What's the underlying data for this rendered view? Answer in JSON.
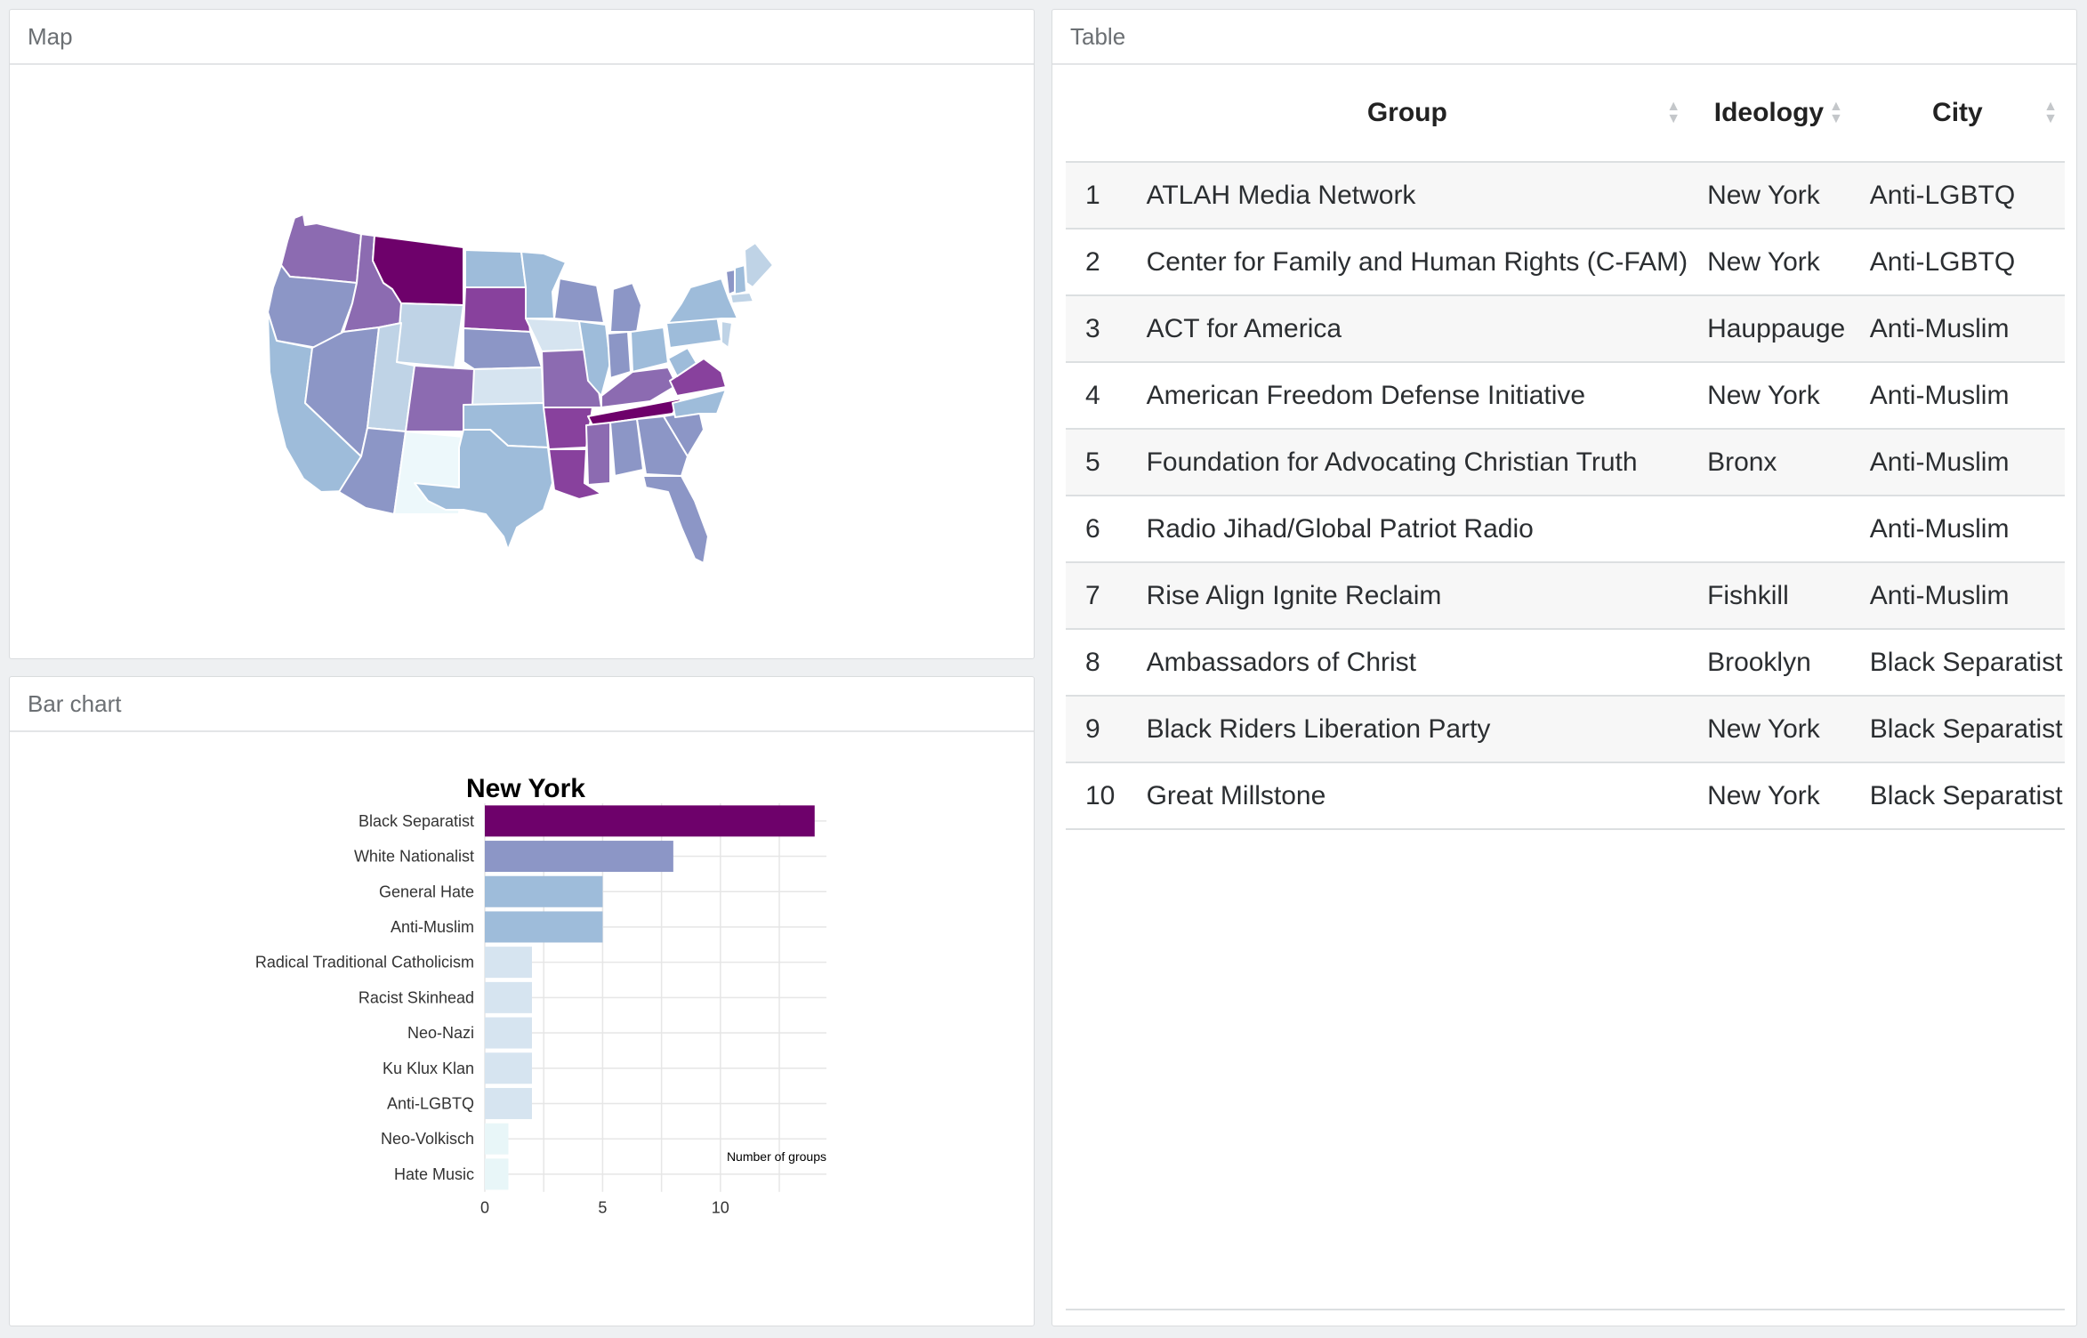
{
  "panels": {
    "map_title": "Map",
    "bar_title": "Bar chart",
    "table_title": "Table"
  },
  "map": {
    "description_colors": [
      "#edf8fb",
      "#bfd3e6",
      "#9ebcda",
      "#8c96c6",
      "#8c6bb1",
      "#88419d",
      "#6e016b"
    ]
  },
  "table": {
    "columns": [
      "",
      "Group",
      "Ideology",
      "City"
    ],
    "rows": [
      {
        "n": "1",
        "group": "ATLAH Media Network",
        "ideology": "New York",
        "city": "Anti-LGBTQ"
      },
      {
        "n": "2",
        "group": "Center for Family and Human Rights (C-FAM)",
        "ideology": "New York",
        "city": "Anti-LGBTQ"
      },
      {
        "n": "3",
        "group": "ACT for America",
        "ideology": "Hauppauge",
        "city": "Anti-Muslim"
      },
      {
        "n": "4",
        "group": "American Freedom Defense Initiative",
        "ideology": "New York",
        "city": "Anti-Muslim"
      },
      {
        "n": "5",
        "group": "Foundation for Advocating Christian Truth",
        "ideology": "Bronx",
        "city": "Anti-Muslim"
      },
      {
        "n": "6",
        "group": "Radio Jihad/Global Patriot Radio",
        "ideology": "",
        "city": "Anti-Muslim"
      },
      {
        "n": "7",
        "group": "Rise Align Ignite Reclaim",
        "ideology": "Fishkill",
        "city": "Anti-Muslim"
      },
      {
        "n": "8",
        "group": "Ambassadors of Christ",
        "ideology": "Brooklyn",
        "city": "Black Separatist"
      },
      {
        "n": "9",
        "group": "Black Riders Liberation Party",
        "ideology": "New York",
        "city": "Black Separatist"
      },
      {
        "n": "10",
        "group": "Great Millstone",
        "ideology": "New York",
        "city": "Black Separatist"
      }
    ]
  },
  "chart_data": {
    "type": "bar",
    "orientation": "horizontal",
    "title": "New York",
    "xlabel": "Number of groups",
    "ylabel": "",
    "xlim": [
      0,
      14.5
    ],
    "xticks": [
      0,
      5,
      10
    ],
    "grid": true,
    "categories": [
      "Black Separatist",
      "White Nationalist",
      "General Hate",
      "Anti-Muslim",
      "Radical Traditional Catholicism",
      "Racist Skinhead",
      "Neo-Nazi",
      "Ku Klux Klan",
      "Anti-LGBTQ",
      "Neo-Volkisch",
      "Hate Music"
    ],
    "values": [
      14,
      8,
      5,
      5,
      2,
      2,
      2,
      2,
      2,
      1,
      1
    ],
    "colors": [
      "#6e016b",
      "#8c96c6",
      "#9ebcda",
      "#9ebcda",
      "#d6e4f0",
      "#d6e4f0",
      "#d6e4f0",
      "#d6e4f0",
      "#d6e4f0",
      "#e8f6f8",
      "#e8f6f8"
    ]
  }
}
